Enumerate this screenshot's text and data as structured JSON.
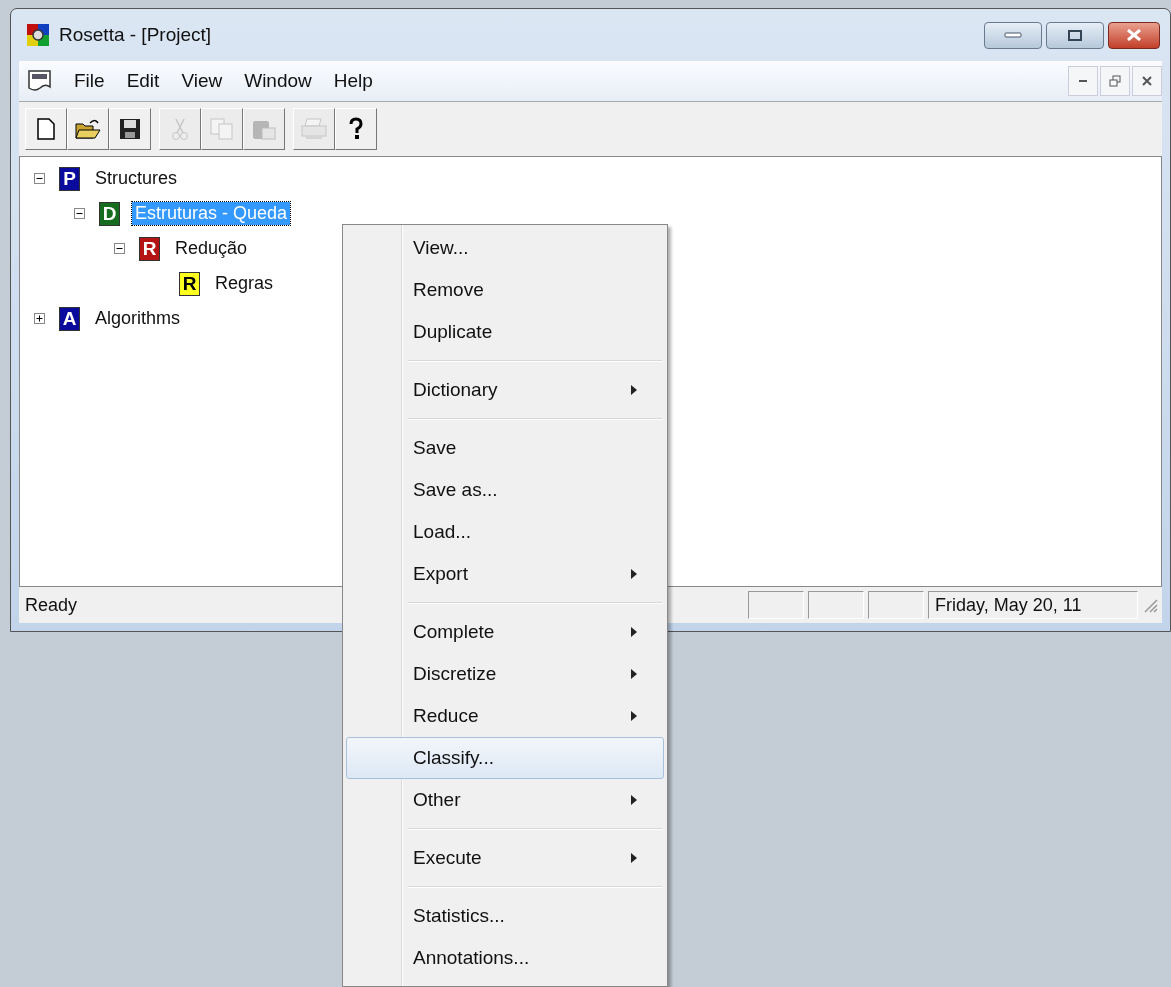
{
  "window": {
    "title": "Rosetta - [Project]"
  },
  "menu_bar": [
    "File",
    "Edit",
    "View",
    "Window",
    "Help"
  ],
  "toolbar": [
    [
      {
        "kind": "new",
        "disabled": false
      },
      {
        "kind": "open",
        "disabled": false
      },
      {
        "kind": "save",
        "disabled": false
      }
    ],
    [
      {
        "kind": "cut",
        "disabled": true
      },
      {
        "kind": "copy",
        "disabled": true
      },
      {
        "kind": "paste",
        "disabled": true
      }
    ],
    [
      {
        "kind": "print",
        "disabled": true
      },
      {
        "kind": "help",
        "disabled": false
      }
    ]
  ],
  "tree": [
    {
      "badge": "P",
      "color": "#0a0a9c",
      "label": "Structures",
      "selected": false,
      "expanded": true,
      "children": [
        {
          "badge": "D",
          "color": "#156b1e",
          "label": "Estruturas - Queda",
          "selected": true,
          "expanded": true,
          "children": [
            {
              "badge": "R",
              "color": "#b41414",
              "label": "Redução",
              "selected": false,
              "expanded": true,
              "children": [
                {
                  "badge": "R",
                  "color": "#ffff20",
                  "label": "Regras",
                  "selected": false
                }
              ]
            }
          ]
        }
      ]
    },
    {
      "badge": "A",
      "color": "#0a0a9c",
      "label": "Algorithms",
      "selected": false,
      "expanded": false
    }
  ],
  "status_bar": {
    "text": "Ready",
    "date": "Friday, May 20, 11"
  },
  "context_menu": [
    [
      {
        "label": "View...",
        "submenu": false,
        "selected": false
      },
      {
        "label": "Remove",
        "submenu": false,
        "selected": false
      },
      {
        "label": "Duplicate",
        "submenu": false,
        "selected": false
      }
    ],
    [
      {
        "label": "Dictionary",
        "submenu": true,
        "selected": false
      }
    ],
    [
      {
        "label": "Save",
        "submenu": false,
        "selected": false
      },
      {
        "label": "Save as...",
        "submenu": false,
        "selected": false
      },
      {
        "label": "Load...",
        "submenu": false,
        "selected": false
      },
      {
        "label": "Export",
        "submenu": true,
        "selected": false
      }
    ],
    [
      {
        "label": "Complete",
        "submenu": true,
        "selected": false
      },
      {
        "label": "Discretize",
        "submenu": true,
        "selected": false
      },
      {
        "label": "Reduce",
        "submenu": true,
        "selected": false
      },
      {
        "label": "Classify...",
        "submenu": false,
        "selected": true
      },
      {
        "label": "Other",
        "submenu": true,
        "selected": false
      }
    ],
    [
      {
        "label": "Execute",
        "submenu": true,
        "selected": false
      }
    ],
    [
      {
        "label": "Statistics...",
        "submenu": false,
        "selected": false
      },
      {
        "label": "Annotations...",
        "submenu": false,
        "selected": false
      }
    ]
  ]
}
